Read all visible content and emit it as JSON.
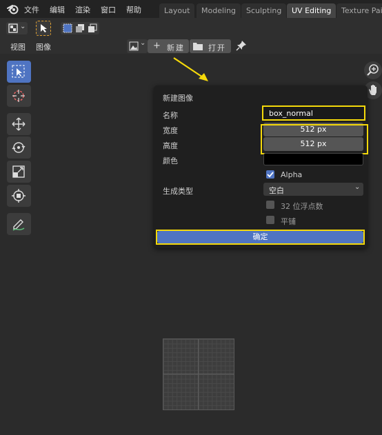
{
  "app": {
    "logo_icon": "blender-logo-icon"
  },
  "menu": [
    "文件",
    "编辑",
    "渲染",
    "窗口",
    "帮助"
  ],
  "workspace_tabs": [
    {
      "label": "Layout",
      "active": false
    },
    {
      "label": "Modeling",
      "active": false
    },
    {
      "label": "Sculpting",
      "active": false
    },
    {
      "label": "UV Editing",
      "active": true
    },
    {
      "label": "Texture Pair",
      "active": false
    }
  ],
  "header": {
    "view_menu": "视图",
    "image_menu": "图像",
    "new_button": "新建",
    "open_button": "打开"
  },
  "tools": [
    {
      "name": "select-box-tool",
      "active": true
    },
    {
      "name": "cursor-tool",
      "active": false
    },
    {
      "name": "move-tool",
      "active": false
    },
    {
      "name": "rotate-tool",
      "active": false
    },
    {
      "name": "scale-tool",
      "active": false
    },
    {
      "name": "transform-tool",
      "active": false
    },
    {
      "name": "annotate-tool",
      "active": false
    }
  ],
  "popup": {
    "title": "新建图像",
    "name_label": "名称",
    "name_value": "box_normal",
    "width_label": "宽度",
    "width_value": "512 px",
    "height_label": "高度",
    "height_value": "512 px",
    "color_label": "颜色",
    "color_value": "#000000",
    "alpha_label": "Alpha",
    "alpha_checked": true,
    "gen_type_label": "生成类型",
    "gen_type_value": "空白",
    "float_label": "32 位浮点数",
    "float_checked": false,
    "tiled_label": "平铺",
    "tiled_checked": false,
    "ok_button": "确定"
  },
  "colors": {
    "accent": "#4f74c2",
    "highlight": "#f5d90a",
    "arrow": "#f5d90a"
  }
}
